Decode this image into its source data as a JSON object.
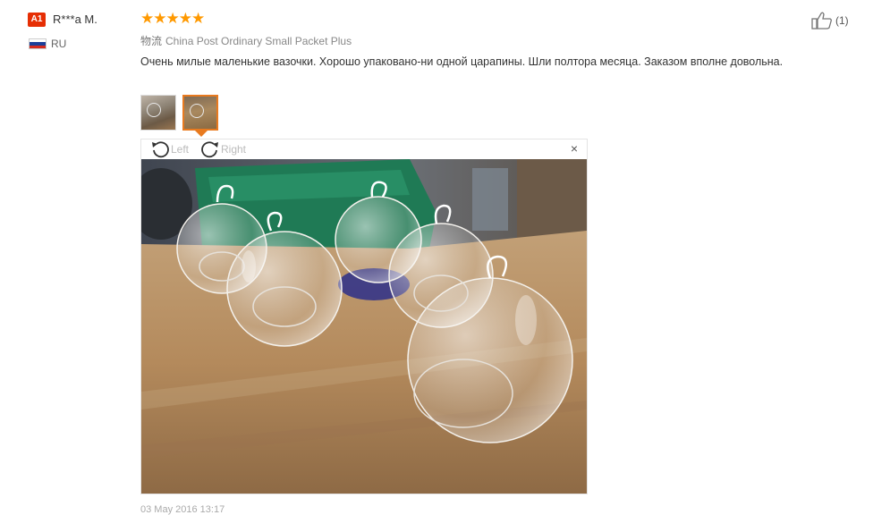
{
  "user": {
    "badge": "A1",
    "name": "R***a M.",
    "country": "RU",
    "flag_colors": [
      "#ffffff",
      "#1c3f99",
      "#d52b1e"
    ]
  },
  "review": {
    "rating": 5,
    "stars_text": "★★★★★",
    "star_color": "#ff9900",
    "shipping_label": "物流",
    "shipping_method": "China Post Ordinary Small Packet Plus",
    "text": "Очень милые маленькие вазочки. Хорошо упаковано-ни одной царапины. Шли полтора месяца. Заказом вполне довольна.",
    "date": "03 May 2016 13:17"
  },
  "viewer": {
    "rotate_left_label": "Left",
    "rotate_right_label": "Right",
    "close_symbol": "×",
    "selected_thumb": 2,
    "accent_color": "#e87a1f"
  },
  "helpful": {
    "count": "(1)"
  }
}
